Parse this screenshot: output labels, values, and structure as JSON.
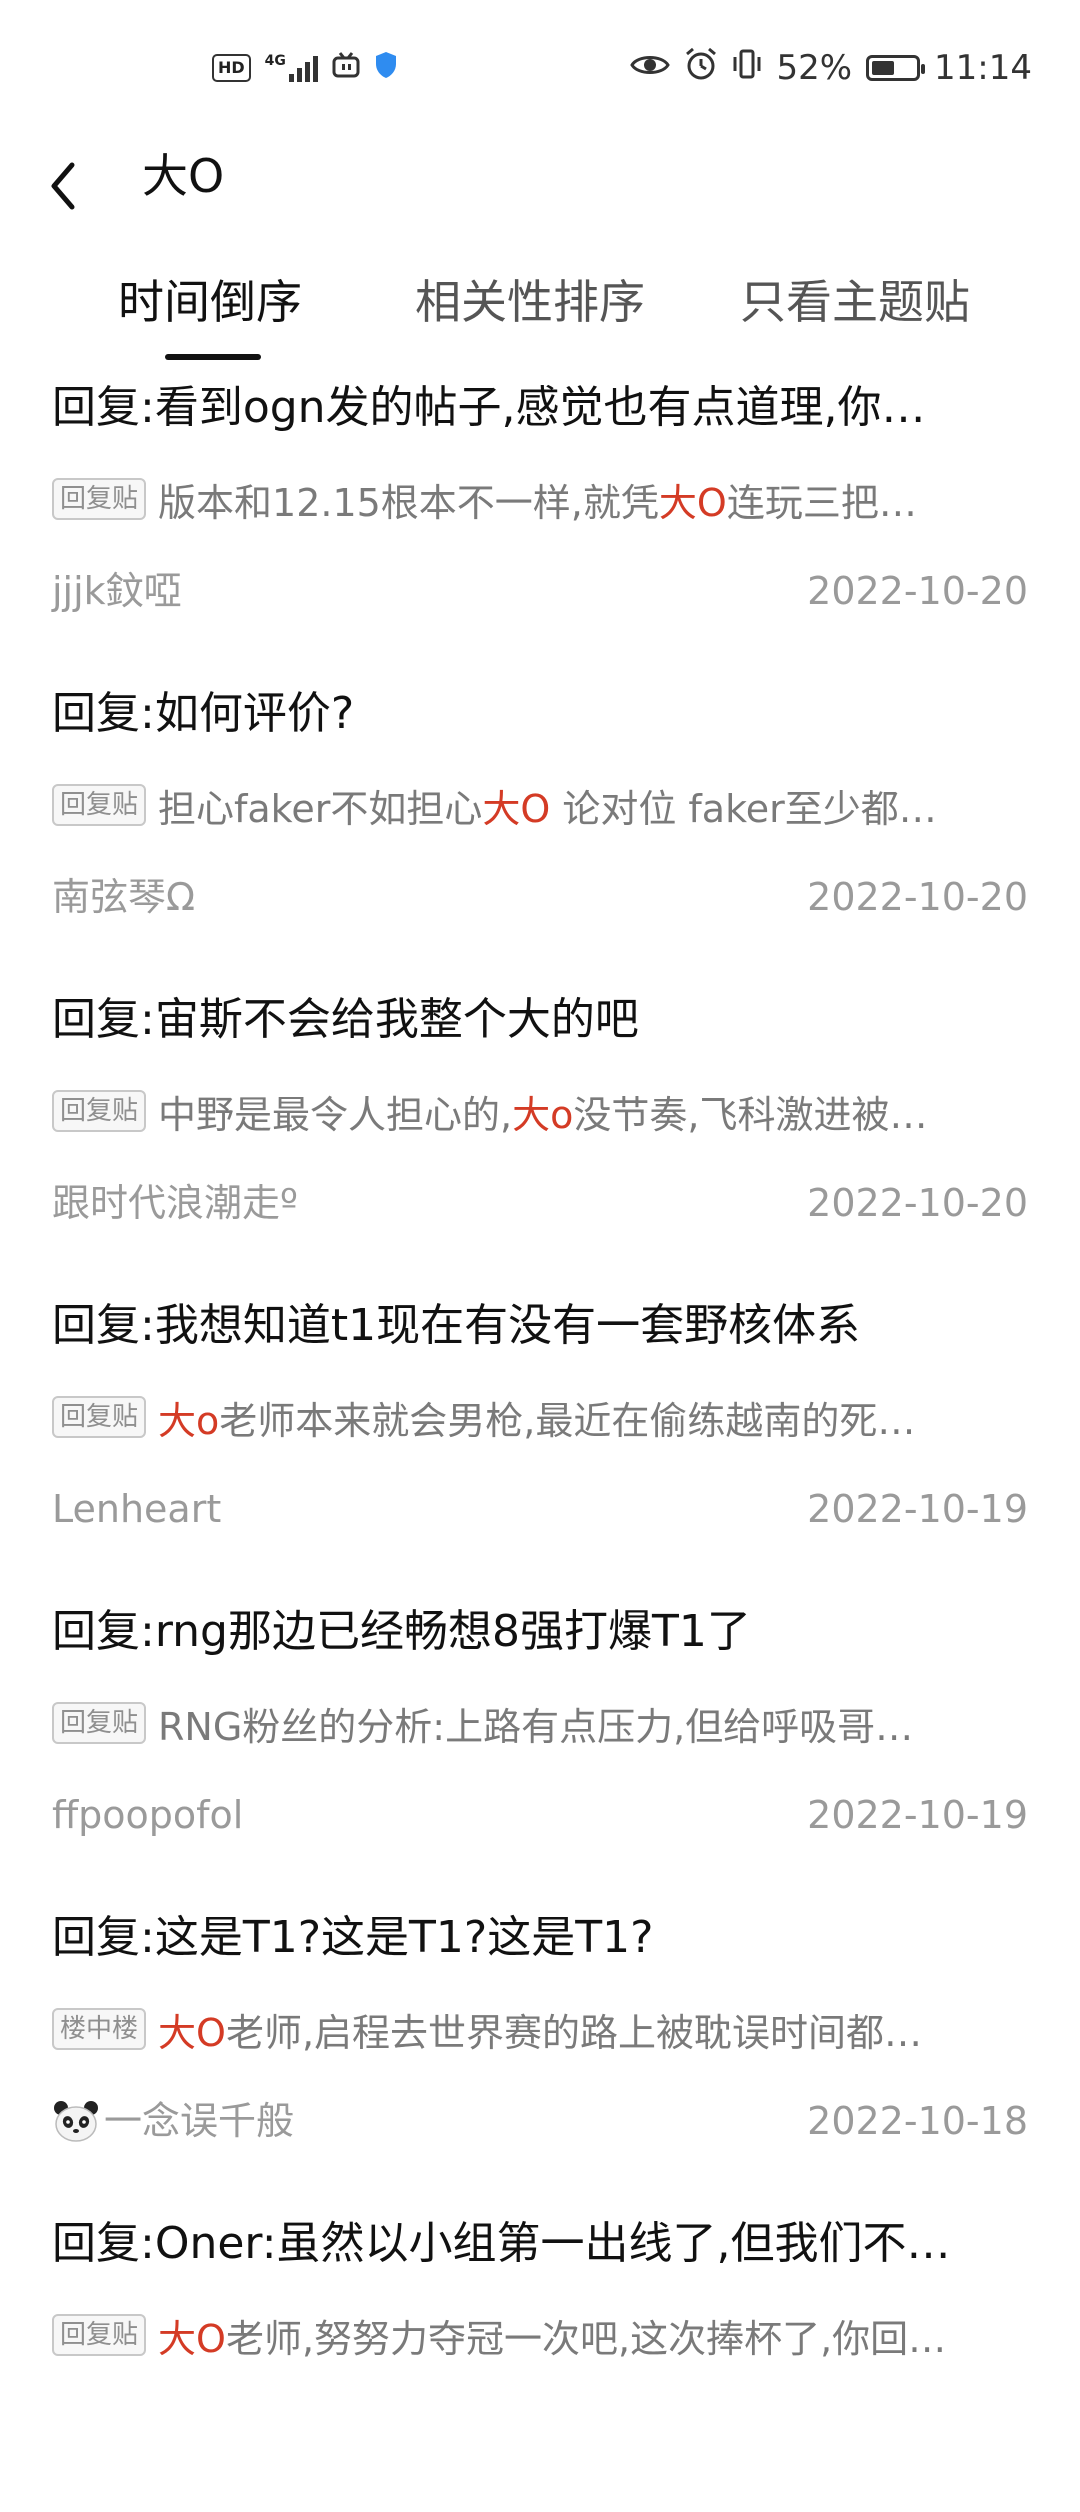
{
  "status_bar": {
    "hd": "HD",
    "network": "4G",
    "battery_percent": "52%",
    "battery_level": 0.52,
    "time": "11:14",
    "icons": [
      "hd-icon",
      "signal-icon",
      "tv-icon",
      "shield-icon",
      "eye-icon",
      "alarm-icon",
      "vibrate-icon",
      "battery-icon"
    ]
  },
  "header": {
    "title": "大O",
    "back_icon": "back-chevron-icon"
  },
  "tabs": [
    {
      "label": "时间倒序",
      "active": true
    },
    {
      "label": "相关性排序",
      "active": false
    },
    {
      "label": "只看主题贴",
      "active": false
    }
  ],
  "posts": [
    {
      "title": "回复:看到ogn发的帖子,感觉也有点道理,你…",
      "tag": "回复贴",
      "snippet_pre": "版本和12.15根本不一样,就凭",
      "snippet_hl": "大O",
      "snippet_post": "连玩三把…",
      "author": "jjjk鈫啞",
      "date": "2022-10-20"
    },
    {
      "title": "回复:如何评价?",
      "tag": "回复贴",
      "snippet_pre": "担心faker不如担心",
      "snippet_hl": "大O",
      "snippet_post": " 论对位 faker至少都…",
      "author": "南弦琴Ω",
      "date": "2022-10-20"
    },
    {
      "title": "回复:宙斯不会给我整个大的吧",
      "tag": "回复贴",
      "snippet_pre": "中野是最令人担心的,",
      "snippet_hl": "大o",
      "snippet_post": "没节奏,飞科激进被…",
      "author": "跟时代浪潮走º",
      "date": "2022-10-20"
    },
    {
      "title": "回复:我想知道t1现在有没有一套野核体系",
      "tag": "回复贴",
      "snippet_pre": "",
      "snippet_hl": "大o",
      "snippet_post": "老师本来就会男枪,最近在偷练越南的死…",
      "author": "Lenheart",
      "date": "2022-10-19"
    },
    {
      "title": "回复:rng那边已经畅想8强打爆T1了",
      "tag": "回复贴",
      "snippet_pre": "RNG粉丝的分析:上路有点压力,但给呼吸哥…",
      "snippet_hl": "",
      "snippet_post": "",
      "author": "ffpoopofol",
      "date": "2022-10-19"
    },
    {
      "title": "回复:这是T1?这是T1?这是T1?",
      "tag": "楼中楼",
      "snippet_pre": "",
      "snippet_hl": "大O",
      "snippet_post": "老师,启程去世界赛的路上被耽误时间都…",
      "author": "一念误千般",
      "author_icon": "panda-icon",
      "date": "2022-10-18"
    },
    {
      "title": "回复:Oner:虽然以小组第一出线了,但我们不…",
      "tag": "回复贴",
      "snippet_pre": "",
      "snippet_hl": "大O",
      "snippet_post": "老师,努努力夺冠一次吧,这次捧杯了,你回…",
      "author": "",
      "date": ""
    }
  ]
}
